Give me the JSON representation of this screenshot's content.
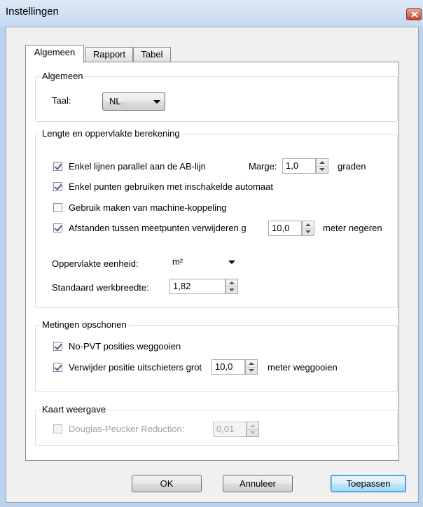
{
  "window": {
    "title": "Instellingen"
  },
  "tabs": [
    {
      "label": "Algemeen"
    },
    {
      "label": "Rapport"
    },
    {
      "label": "Tabel"
    }
  ],
  "general": {
    "group_title": "Algemeen",
    "language_label": "Taal:",
    "language_value": "NL"
  },
  "length_area": {
    "group_title": "Lengte en oppervlakte berekening",
    "parallel_ab": {
      "label": "Enkel lijnen parallel aan de AB-lijn",
      "checked": true
    },
    "margin_label": "Marge:",
    "margin_value": "1,0",
    "margin_unit": "graden",
    "points_auto": {
      "label": "Enkel punten gebruiken met inschakelde automaat",
      "checked": true
    },
    "machine_coupling": {
      "label": "Gebruik maken van machine-koppeling",
      "checked": false
    },
    "distance_remove": {
      "label": "Afstanden tussen meetpunten verwijderen g",
      "checked": true
    },
    "distance_value": "10,0",
    "distance_unit": "meter negeren",
    "area_unit_label": "Oppervlakte eenheid:",
    "area_unit_value": "m²",
    "work_width_label": "Standaard werkbreedte:",
    "work_width_value": "1,82"
  },
  "cleanup": {
    "group_title": "Metingen opschonen",
    "no_pvt": {
      "label": "No-PVT posities weggooien",
      "checked": true
    },
    "outliers": {
      "label": "Verwijder positie uitschieters grot",
      "checked": true
    },
    "outlier_value": "10,0",
    "outlier_unit": "meter weggooien"
  },
  "map_view": {
    "group_title": "Kaart weergave",
    "douglas_peucker": {
      "label": "Douglas-Peucker Reduction:",
      "checked": false,
      "enabled": false
    },
    "dp_value": "0,01"
  },
  "buttons": {
    "ok": "OK",
    "cancel": "Annuleer",
    "apply": "Toepassen"
  }
}
